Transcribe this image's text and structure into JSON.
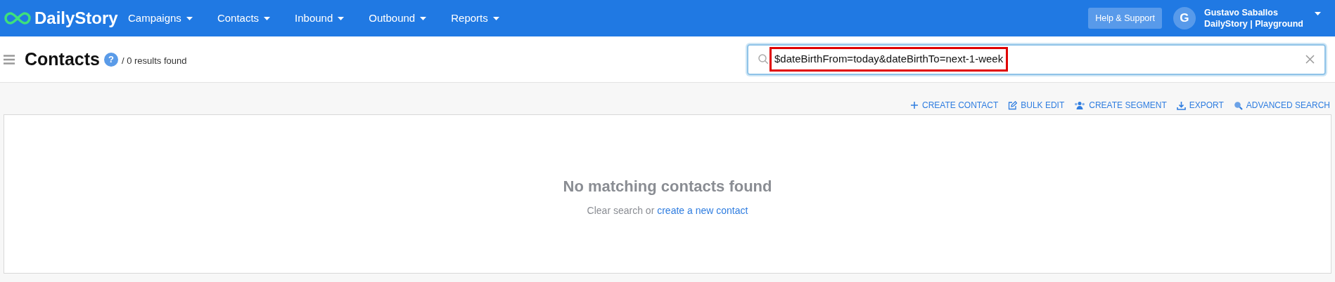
{
  "brand": "DailyStory",
  "nav": [
    {
      "label": "Campaigns"
    },
    {
      "label": "Contacts"
    },
    {
      "label": "Inbound"
    },
    {
      "label": "Outbound"
    },
    {
      "label": "Reports"
    }
  ],
  "help_button": "Help & Support",
  "user": {
    "initial": "G",
    "name": "Gustavo Saballos",
    "account": "DailyStory | Playground"
  },
  "page": {
    "title": "Contacts",
    "help": "?",
    "results": "/ 0 results found"
  },
  "search": {
    "value": "$dateBirthFrom=today&dateBirthTo=next-1-week",
    "highlighted": true
  },
  "actions": [
    {
      "kind": "plus",
      "label": "CREATE CONTACT"
    },
    {
      "kind": "edit",
      "label": "BULK EDIT"
    },
    {
      "kind": "people",
      "label": "CREATE SEGMENT"
    },
    {
      "kind": "download",
      "label": "EXPORT"
    },
    {
      "kind": "zoom",
      "label": "ADVANCED SEARCH"
    }
  ],
  "empty": {
    "title": "No matching contacts found",
    "text": "Clear search or",
    "link": "create a new contact"
  }
}
